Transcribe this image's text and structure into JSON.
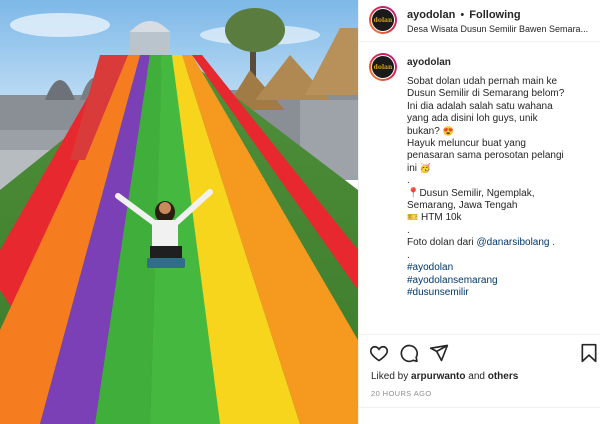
{
  "header": {
    "username": "ayodolan",
    "separator": "•",
    "follow_status": "Following",
    "location": "Desa Wisata Dusun Semilir Bawen Semara..."
  },
  "avatar": {
    "logo_text": "dolan"
  },
  "caption": {
    "username": "ayodolan",
    "lines": [
      "Sobat dolan udah pernah main ke",
      "Dusun Semilir di Semarang belom?",
      "Ini dia adalah salah satu wahana",
      "yang ada disini loh guys, unik",
      "bukan?"
    ],
    "line2": [
      "Hayuk meluncur buat yang",
      "penasaran sama perosotan pelangi",
      "ini"
    ],
    "dot1": ".",
    "address": [
      "Dusun Semilir, Ngemplak,",
      "Semarang, Jawa Tengah"
    ],
    "htm": "HTM 10k",
    "dot2": ".",
    "credit_prefix": "Foto dolan dari ",
    "credit_handle": "@danarsibolang",
    "credit_suffix": " .",
    "dot3": ".",
    "hashtags": [
      "#ayodolan",
      "#ayodolansemarang",
      "#dusunsemilir"
    ]
  },
  "actions": {
    "like_icon": "heart-icon",
    "comment_icon": "comment-icon",
    "share_icon": "share-icon",
    "save_icon": "bookmark-icon"
  },
  "likes": {
    "prefix": "Liked by ",
    "user": "arpurwanto",
    "middle": " and ",
    "others": "others"
  },
  "timestamp": "20 HOURS AGO",
  "colors": {
    "link": "#00376b",
    "muted": "#8e8e8e",
    "slide_red": "#e8282f",
    "slide_orange": "#f57c1f",
    "slide_yellow": "#f7d51d",
    "slide_green": "#3fae3a",
    "slide_purple": "#7b3fb6"
  }
}
